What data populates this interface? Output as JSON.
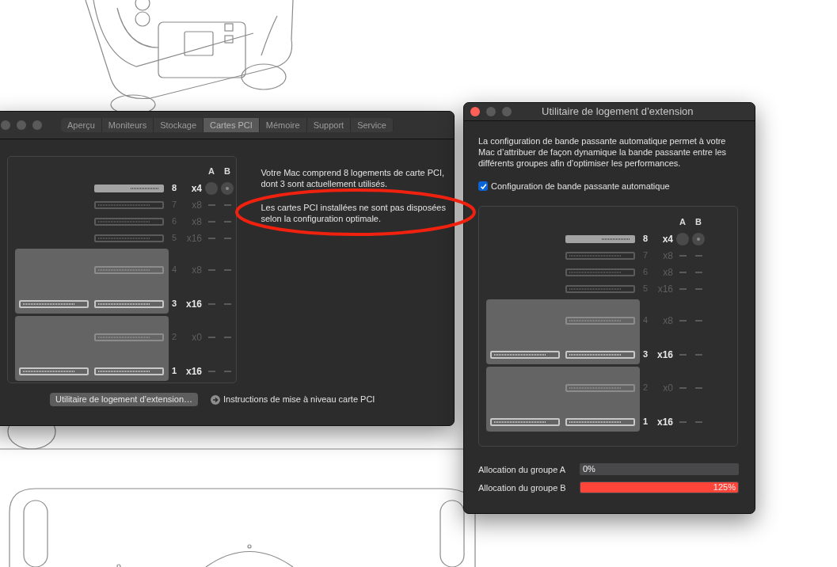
{
  "main_window": {
    "focused": false,
    "tabs": [
      {
        "label": "Aperçu",
        "selected": false
      },
      {
        "label": "Moniteurs",
        "selected": false
      },
      {
        "label": "Stockage",
        "selected": false
      },
      {
        "label": "Cartes PCI",
        "selected": true
      },
      {
        "label": "Mémoire",
        "selected": false
      },
      {
        "label": "Support",
        "selected": false
      },
      {
        "label": "Service",
        "selected": false
      }
    ],
    "slot_panel": {
      "columns": [
        "A",
        "B"
      ],
      "slots": [
        {
          "number": "8",
          "lanes": "x4",
          "active": true,
          "card": true,
          "in_group": true,
          "a_selected": false,
          "b_selected": true
        },
        {
          "number": "7",
          "lanes": "x8",
          "active": false,
          "card": false,
          "in_group": false
        },
        {
          "number": "6",
          "lanes": "x8",
          "active": false,
          "card": false,
          "in_group": false
        },
        {
          "number": "5",
          "lanes": "x16",
          "active": false,
          "card": false,
          "in_group": false
        }
      ],
      "modules": [
        {
          "slots": [
            {
              "number": "4",
              "lanes": "x8",
              "active": false,
              "card": false,
              "in_group": false
            },
            {
              "number": "3",
              "lanes": "x16",
              "active": true,
              "card": false,
              "double": true,
              "in_group": false
            }
          ]
        },
        {
          "slots": [
            {
              "number": "2",
              "lanes": "x0",
              "active": false,
              "card": false,
              "in_group": false
            },
            {
              "number": "1",
              "lanes": "x16",
              "active": true,
              "card": false,
              "double": true,
              "in_group": false
            }
          ]
        }
      ]
    },
    "info": [
      "Votre Mac comprend 8 logements de carte PCI, dont 3 sont actuellement utilisés.",
      "Les cartes PCI installées ne sont pas disposées selon la configuration optimale."
    ],
    "button": "Utilitaire de logement d’extension…",
    "link": "Instructions de mise à niveau carte PCI"
  },
  "utility_window": {
    "focused": true,
    "title": "Utilitaire de logement d’extension",
    "description": "La configuration de bande passante automatique permet à votre Mac d’attribuer de façon dynamique la bande passante entre les différents groupes afin d’optimiser les performances.",
    "checkbox": {
      "label": "Configuration de bande passante automatique",
      "checked": true
    },
    "slot_panel": {
      "columns": [
        "A",
        "B"
      ],
      "slots": [
        {
          "number": "8",
          "lanes": "x4",
          "active": true,
          "card": true,
          "in_group": true,
          "a_selected": false,
          "b_selected": true
        },
        {
          "number": "7",
          "lanes": "x8",
          "active": false,
          "card": false,
          "in_group": false
        },
        {
          "number": "6",
          "lanes": "x8",
          "active": false,
          "card": false,
          "in_group": false
        },
        {
          "number": "5",
          "lanes": "x16",
          "active": false,
          "card": false,
          "in_group": false
        }
      ],
      "modules": [
        {
          "slots": [
            {
              "number": "4",
              "lanes": "x8",
              "active": false,
              "card": false,
              "in_group": false
            },
            {
              "number": "3",
              "lanes": "x16",
              "active": true,
              "card": false,
              "double": true,
              "in_group": false
            }
          ]
        },
        {
          "slots": [
            {
              "number": "2",
              "lanes": "x0",
              "active": false,
              "card": false,
              "in_group": false
            },
            {
              "number": "1",
              "lanes": "x16",
              "active": true,
              "card": false,
              "double": true,
              "in_group": false
            }
          ]
        }
      ]
    },
    "allocations": [
      {
        "label": "Allocation du groupe A",
        "value": "0%",
        "level": 0
      },
      {
        "label": "Allocation du groupe B",
        "value": "125%",
        "level": 1
      }
    ]
  }
}
